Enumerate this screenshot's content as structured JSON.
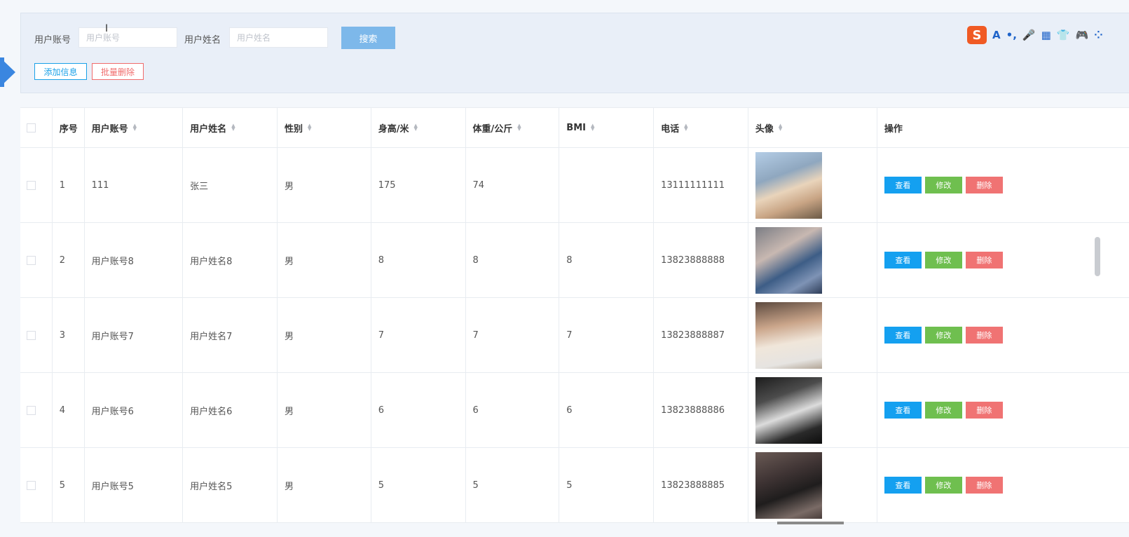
{
  "search": {
    "account_label": "用户账号",
    "account_placeholder": "用户账号",
    "name_label": "用户姓名",
    "name_placeholder": "用户姓名",
    "search_button": "搜索",
    "add_button": "添加信息",
    "bulk_delete_button": "批量删除"
  },
  "ime_toolbar": {
    "logo": "S",
    "items": [
      "A",
      "•,",
      "🎤",
      "▦",
      "👕",
      "🎮",
      "⁘"
    ]
  },
  "table": {
    "headers": [
      "序号",
      "用户账号",
      "用户姓名",
      "性别",
      "身高/米",
      "体重/公斤",
      "BMI",
      "电话",
      "头像",
      "操作"
    ],
    "rows": [
      {
        "index": "1",
        "account": "111",
        "name": "张三",
        "gender": "男",
        "height": "175",
        "weight": "74",
        "bmi": "",
        "phone": "13111111111"
      },
      {
        "index": "2",
        "account": "用户账号8",
        "name": "用户姓名8",
        "gender": "男",
        "height": "8",
        "weight": "8",
        "bmi": "8",
        "phone": "13823888888"
      },
      {
        "index": "3",
        "account": "用户账号7",
        "name": "用户姓名7",
        "gender": "男",
        "height": "7",
        "weight": "7",
        "bmi": "7",
        "phone": "13823888887"
      },
      {
        "index": "4",
        "account": "用户账号6",
        "name": "用户姓名6",
        "gender": "男",
        "height": "6",
        "weight": "6",
        "bmi": "6",
        "phone": "13823888886"
      },
      {
        "index": "5",
        "account": "用户账号5",
        "name": "用户姓名5",
        "gender": "男",
        "height": "5",
        "weight": "5",
        "bmi": "5",
        "phone": "13823888885"
      }
    ],
    "actions": {
      "view": "查看",
      "edit": "修改",
      "delete": "删除"
    }
  }
}
